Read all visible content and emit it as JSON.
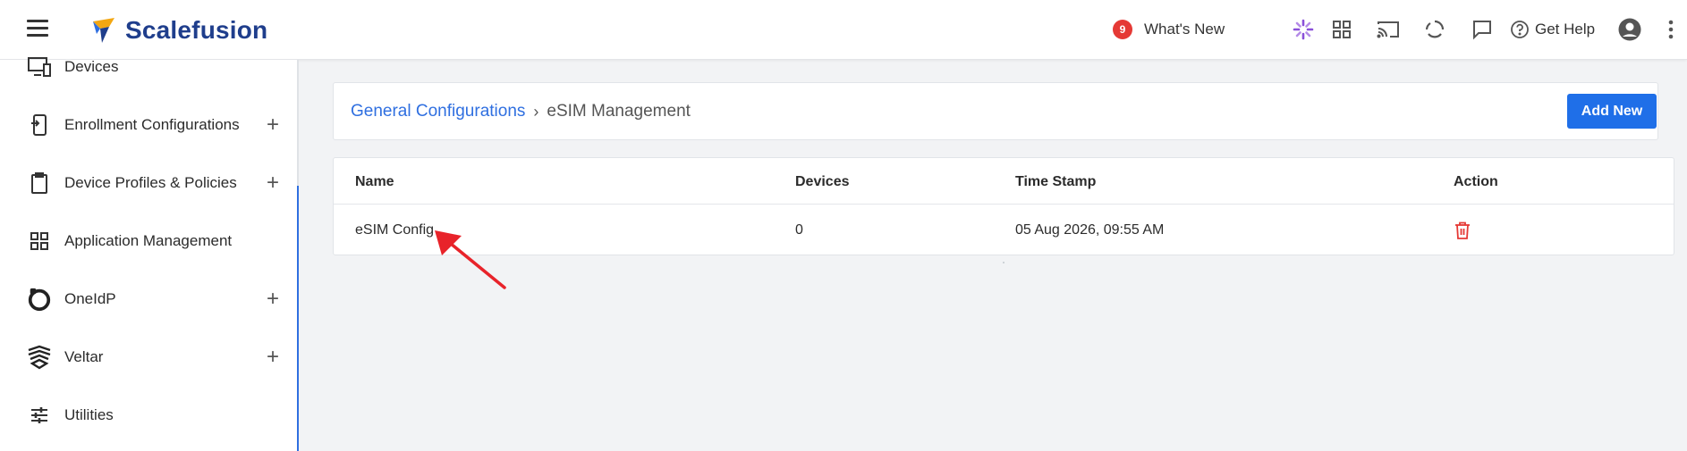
{
  "header": {
    "brand": "Scalefusion",
    "whats_new": {
      "count": "9",
      "label": "What's New"
    },
    "get_help": "Get Help",
    "icons": [
      "menu-icon",
      "spinner-icon",
      "apps-grid-icon",
      "cast-icon",
      "sync-icon",
      "chat-icon",
      "help-circle-icon",
      "account-icon",
      "more-vertical-icon"
    ]
  },
  "sidebar": {
    "items": [
      {
        "label": "Devices",
        "icon": "devices-icon",
        "expandable": false
      },
      {
        "label": "Enrollment Configurations",
        "icon": "enrollment-icon",
        "expandable": true
      },
      {
        "label": "Device Profiles & Policies",
        "icon": "clipboard-icon",
        "expandable": true
      },
      {
        "label": "Application Management",
        "icon": "apps-grid-icon",
        "expandable": false
      },
      {
        "label": "OneIdP",
        "icon": "oneidp-icon",
        "expandable": true
      },
      {
        "label": "Veltar",
        "icon": "veltar-icon",
        "expandable": true
      },
      {
        "label": "Utilities",
        "icon": "sliders-icon",
        "expandable": false
      }
    ],
    "plus": "+"
  },
  "breadcrumb": {
    "parent": "General Configurations",
    "separator": "›",
    "current": "eSIM Management"
  },
  "add_button": "Add New",
  "table": {
    "headers": {
      "name": "Name",
      "devices": "Devices",
      "timestamp": "Time Stamp",
      "action": "Action"
    },
    "rows": [
      {
        "name": "eSIM Config",
        "devices": "0",
        "timestamp": "05 Aug 2026, 09:55 AM",
        "action": "trash-icon"
      }
    ]
  },
  "colors": {
    "brand_blue": "#1f3e8c",
    "link_blue": "#2f6fe0",
    "primary_button": "#1f6fe8",
    "badge_red": "#e53935",
    "delete_red": "#e53935",
    "annotation_arrow": "#e8232a"
  }
}
